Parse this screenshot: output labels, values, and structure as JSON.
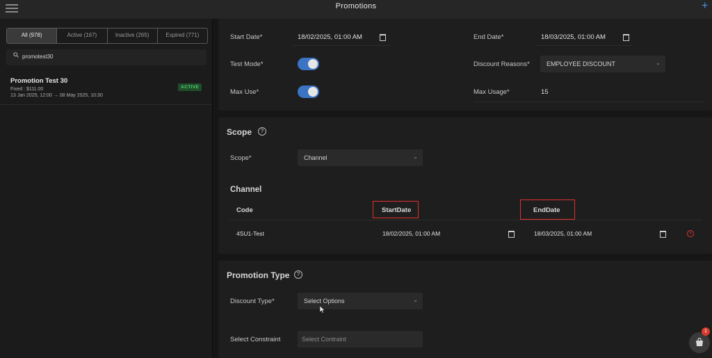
{
  "header": {
    "title": "Promotions",
    "add_icon": "plus-icon",
    "menu_icon": "hamburger-menu-icon"
  },
  "filters": {
    "tabs": [
      {
        "label": "All (978)"
      },
      {
        "label": "Active (167)"
      },
      {
        "label": "Inactive (265)"
      },
      {
        "label": "Expired (771)"
      }
    ],
    "selected": "All (978)"
  },
  "search": {
    "value": "promotest30",
    "icon": "search-icon"
  },
  "promotion_list": [
    {
      "name": "Promotion Test 30",
      "type_line": "Fixed : $111.00",
      "date_line": "13 Jan 2025, 12:00 → 08 May 2025, 10:30",
      "status": "ACTIVE"
    }
  ],
  "general": {
    "start_date_label": "Start Date*",
    "start_date_value": "18/02/2025, 01:00 AM",
    "end_date_label": "End Date*",
    "end_date_value": "18/03/2025, 01:00 AM",
    "test_mode_label": "Test Mode*",
    "test_mode_on": true,
    "discount_reasons_label": "Discount Reasons*",
    "discount_reasons_value": "EMPLOYEE DISCOUNT",
    "max_use_label": "Max Use*",
    "max_use_on": true,
    "max_usage_label": "Max Usage*",
    "max_usage_value": "15"
  },
  "scope": {
    "title": "Scope",
    "scope_label": "Scope*",
    "scope_value": "Channel",
    "channel_title": "Channel",
    "columns": {
      "code": "Code",
      "start": "StartDate",
      "end": "EndDate"
    },
    "rows": [
      {
        "code": "4SU1-Test",
        "start": "18/02/2025, 01:00 AM",
        "end": "18/03/2025, 01:00 AM"
      }
    ]
  },
  "promotion_type": {
    "title": "Promotion Type",
    "discount_type_label": "Discount Type*",
    "discount_type_placeholder": "Select Options",
    "constraint_label": "Select Constraint",
    "constraint_placeholder": "Select Contraint"
  },
  "cart": {
    "badge": "1"
  },
  "colors": {
    "accent": "#3b74c4",
    "active_badge": "#4fd06f",
    "highlight": "#e0312e",
    "background": "#161616"
  }
}
